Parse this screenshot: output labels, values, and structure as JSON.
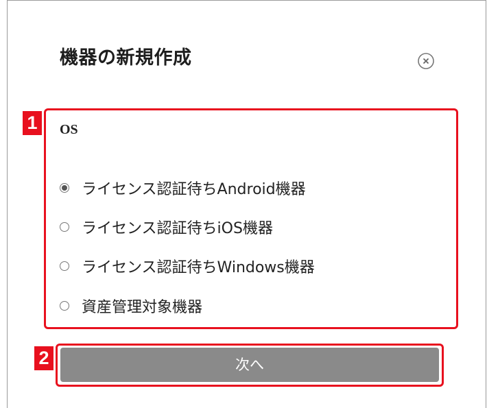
{
  "dialog": {
    "title": "機器の新規作成",
    "close_icon": "circle-x-icon"
  },
  "markers": [
    "1",
    "2"
  ],
  "os_section": {
    "label": "OS",
    "options": [
      {
        "label": "ライセンス認証待ちAndroid機器",
        "selected": true
      },
      {
        "label": "ライセンス認証待ちiOS機器",
        "selected": false
      },
      {
        "label": "ライセンス認証待ちWindows機器",
        "selected": false
      },
      {
        "label": "資産管理対象機器",
        "selected": false
      }
    ]
  },
  "next_button": {
    "label": "次へ"
  },
  "colors": {
    "highlight": "#e8101e",
    "button_bg": "#8a8a8a"
  }
}
